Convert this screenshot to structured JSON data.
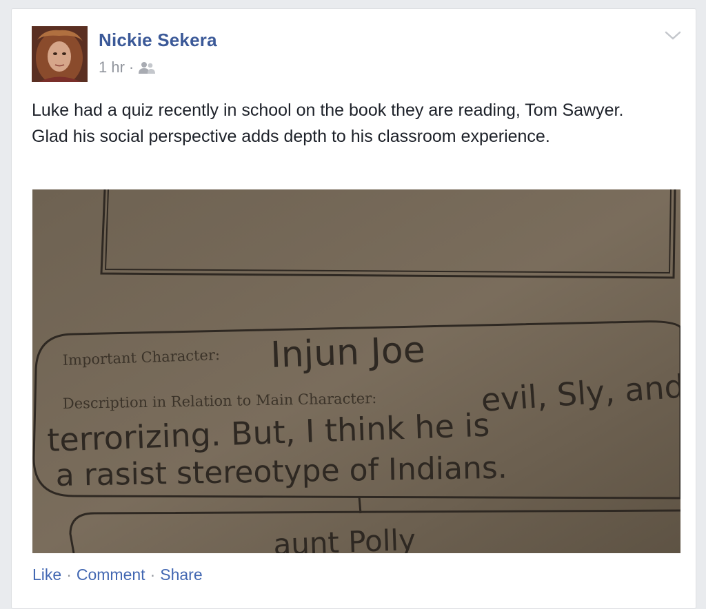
{
  "post": {
    "author": "Nickie Sekera",
    "time": "1 hr",
    "separator": "·",
    "audience_icon": "friends-icon",
    "text": "Luke had a quiz recently in school on the book they are reading, Tom Sawyer. Glad his social perspective adds depth to his classroom experience."
  },
  "photo": {
    "field_label_1": "Important Character:",
    "answer_1": "Injun Joe",
    "field_label_2": "Description in Relation to Main Character:",
    "answer_2a": "evil, Sly, and",
    "answer_2b": "terrorizing. But, I think he is",
    "answer_2c": "a rasist stereotype of Indians.",
    "answer_next": "aunt Polly"
  },
  "actions": {
    "like": "Like",
    "comment": "Comment",
    "share": "Share",
    "separator": "·"
  },
  "colors": {
    "link": "#3b5998",
    "action": "#4267b2",
    "meta": "#90949c",
    "text": "#1d2129"
  }
}
